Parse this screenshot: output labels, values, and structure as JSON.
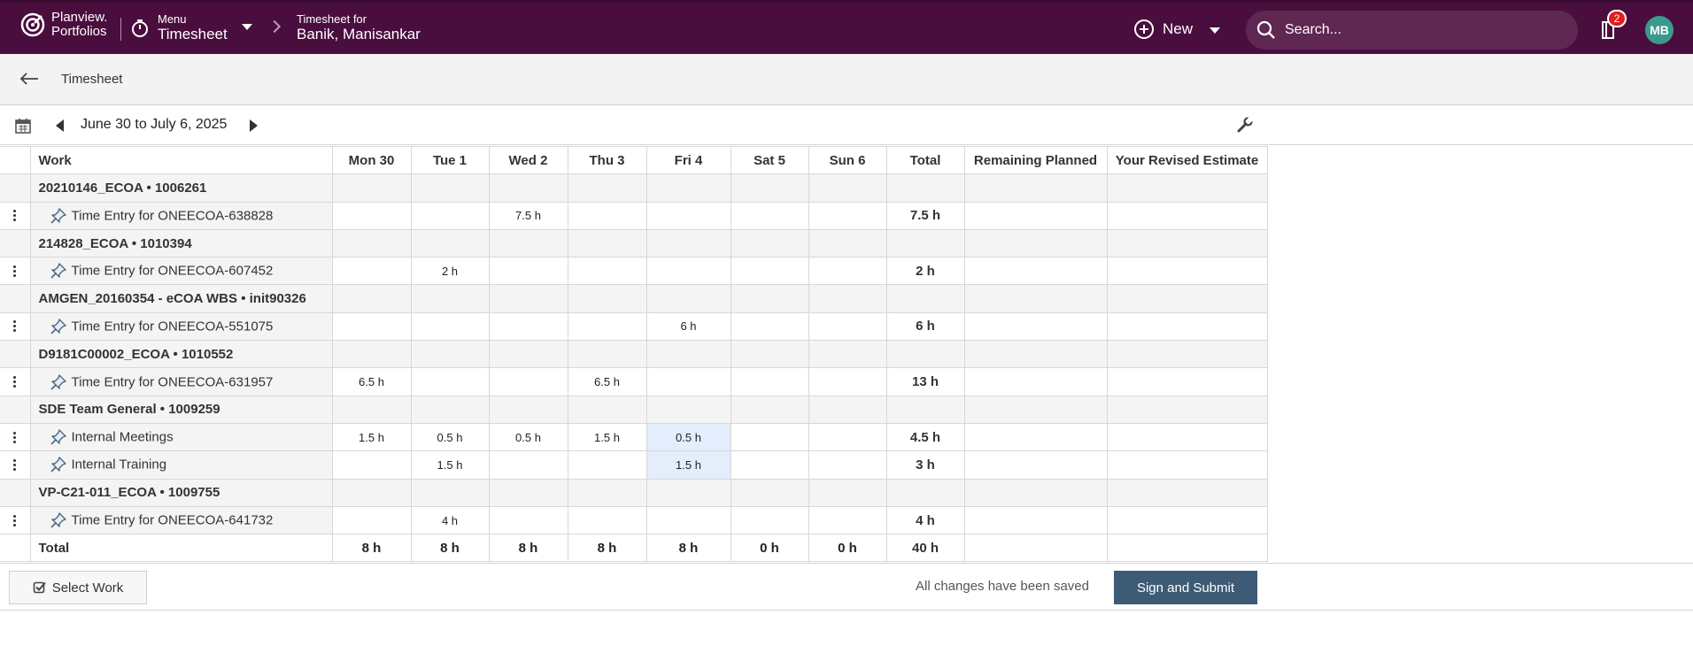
{
  "brand": {
    "line1": "Planview.",
    "line2": "Portfolios"
  },
  "menu": {
    "small": "Menu",
    "big": "Timesheet"
  },
  "breadcrumb": {
    "small": "Timesheet for",
    "big": "Banik, Manisankar"
  },
  "header": {
    "new_label": "New",
    "search_placeholder": "Search...",
    "notification_count": "2",
    "avatar_initials": "MB"
  },
  "subheader": {
    "title": "Timesheet"
  },
  "period": {
    "label": "June 30 to July 6, 2025"
  },
  "columns": {
    "work": "Work",
    "mon": "Mon 30",
    "tue": "Tue 1",
    "wed": "Wed 2",
    "thu": "Thu 3",
    "fri": "Fri 4",
    "sat": "Sat 5",
    "sun": "Sun 6",
    "total": "Total",
    "remaining": "Remaining Planned",
    "revised": "Your Revised Estimate"
  },
  "groups": [
    {
      "name": "20210146_ECOA • 1006261"
    },
    {
      "name": "214828_ECOA • 1010394"
    },
    {
      "name": "AMGEN_20160354 - eCOA WBS • init90326"
    },
    {
      "name": "D9181C00002_ECOA • 1010552"
    },
    {
      "name": "SDE Team General • 1009259"
    },
    {
      "name": "VP-C21-011_ECOA • 1009755"
    }
  ],
  "entries": [
    {
      "label": "Time Entry for ONEECOA-638828",
      "mon": "",
      "tue": "",
      "wed": "7.5 h",
      "thu": "",
      "fri": "",
      "sat": "",
      "sun": "",
      "total": "7.5 h"
    },
    {
      "label": "Time Entry for ONEECOA-607452",
      "mon": "",
      "tue": "2 h",
      "wed": "",
      "thu": "",
      "fri": "",
      "sat": "",
      "sun": "",
      "total": "2 h"
    },
    {
      "label": "Time Entry for ONEECOA-551075",
      "mon": "",
      "tue": "",
      "wed": "",
      "thu": "",
      "fri": "6 h",
      "sat": "",
      "sun": "",
      "total": "6 h"
    },
    {
      "label": "Time Entry for ONEECOA-631957",
      "mon": "6.5 h",
      "tue": "",
      "wed": "",
      "thu": "6.5 h",
      "fri": "",
      "sat": "",
      "sun": "",
      "total": "13 h"
    },
    {
      "label": "Internal Meetings",
      "mon": "1.5 h",
      "tue": "0.5 h",
      "wed": "0.5 h",
      "thu": "1.5 h",
      "fri": "0.5 h",
      "sat": "",
      "sun": "",
      "total": "4.5 h"
    },
    {
      "label": "Internal Training",
      "mon": "",
      "tue": "1.5 h",
      "wed": "",
      "thu": "",
      "fri": "1.5 h",
      "sat": "",
      "sun": "",
      "total": "3 h"
    },
    {
      "label": "Time Entry for ONEECOA-641732",
      "mon": "",
      "tue": "4 h",
      "wed": "",
      "thu": "",
      "fri": "",
      "sat": "",
      "sun": "",
      "total": "4 h"
    }
  ],
  "totals": {
    "label": "Total",
    "mon": "8 h",
    "tue": "8 h",
    "wed": "8 h",
    "thu": "8 h",
    "fri": "8 h",
    "sat": "0 h",
    "sun": "0 h",
    "total": "40 h"
  },
  "footer": {
    "select_work": "Select Work",
    "status": "All changes have been saved",
    "submit": "Sign and Submit"
  },
  "colors": {
    "topbar": "#4a0e3e",
    "accent_button": "#3d5b74",
    "highlight_cell": "#e4edfb",
    "avatar": "#3a9a8e",
    "badge": "#e02020"
  }
}
